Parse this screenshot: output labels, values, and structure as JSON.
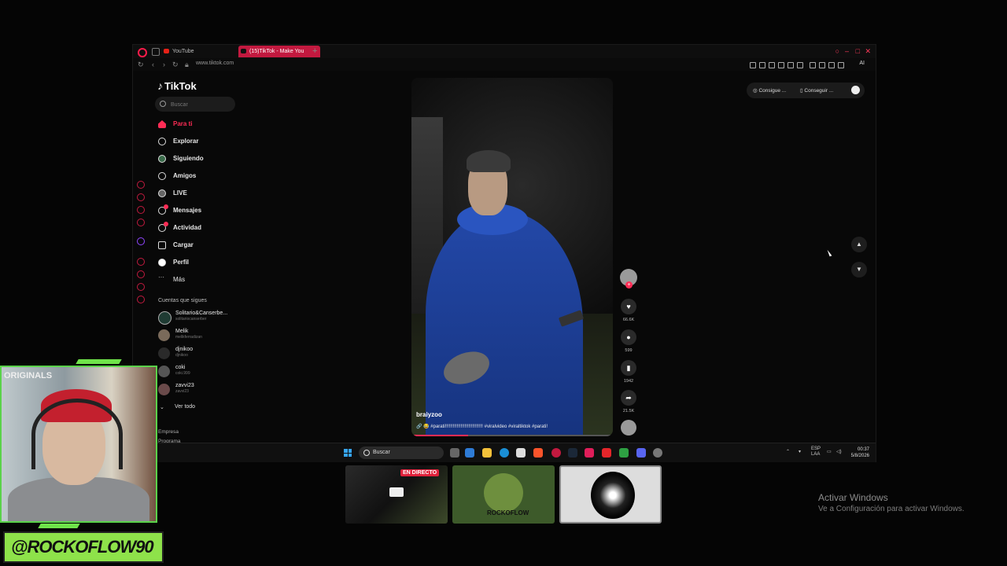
{
  "browser": {
    "tabs": [
      {
        "label": "YouTube"
      },
      {
        "label": "(15)TikTok - Make You"
      }
    ],
    "new_tab": "+",
    "url": "www.tiktok.com",
    "ai_label": "AI"
  },
  "tiktok": {
    "logo": "TikTok",
    "search_placeholder": "Buscar",
    "nav": [
      {
        "label": "Para ti",
        "icon": "home-icon",
        "active": true
      },
      {
        "label": "Explorar",
        "icon": "compass-icon"
      },
      {
        "label": "Siguiendo",
        "icon": "following-icon"
      },
      {
        "label": "Amigos",
        "icon": "friends-icon"
      },
      {
        "label": "LIVE",
        "icon": "live-icon"
      },
      {
        "label": "Mensajes",
        "icon": "messages-icon"
      },
      {
        "label": "Actividad",
        "icon": "activity-icon"
      },
      {
        "label": "Cargar",
        "icon": "upload-icon"
      },
      {
        "label": "Perfil",
        "icon": "profile-icon"
      },
      {
        "label": "Más",
        "icon": "more-icon"
      }
    ],
    "following_title": "Cuentas que sigues",
    "accounts": [
      {
        "name": "Solitario&Canserbe...",
        "handle": "solitariocanserber"
      },
      {
        "name": "Melik",
        "handle": "melikferradizan"
      },
      {
        "name": "djnikoo",
        "handle": "djnikoo"
      },
      {
        "name": "coki",
        "handle": "coki.999"
      },
      {
        "name": "zavvi23",
        "handle": "zavvi23"
      }
    ],
    "see_all": "Ver todo",
    "footer": [
      "Empresa",
      "Programa"
    ],
    "video": {
      "username": "braiyzoo",
      "description": "🔗 😂 #parati!!!!!!!!!!!!!!!!!!!!!!!!!!!!! #viralvideo #viraltiktok #parati!",
      "progress": 0.28
    },
    "actions": {
      "likes": "66.6K",
      "comments": "599",
      "saves": "1942",
      "shares": "21.5K"
    },
    "top_right": {
      "item1": "Consigue ...",
      "item2": "Conseguir ..."
    }
  },
  "taskbar": {
    "search": "Buscar",
    "lang1": "ESP",
    "lang2": "LAA",
    "time": "00:37",
    "date": "5/8/2026"
  },
  "overlay": {
    "live_badge": "EN DIRECTO",
    "thumb_caption": "ROCKOFLOW",
    "webcam_text": "ORIGINALS",
    "handle": "@ROCKOFLOW90"
  },
  "windows": {
    "activate_title": "Activar Windows",
    "activate_sub": "Ve a Configuración para activar Windows."
  },
  "colors": {
    "tiktok_accent": "#fe2c55",
    "opera_red": "#c2193f",
    "handle_green": "#8ee24a"
  }
}
